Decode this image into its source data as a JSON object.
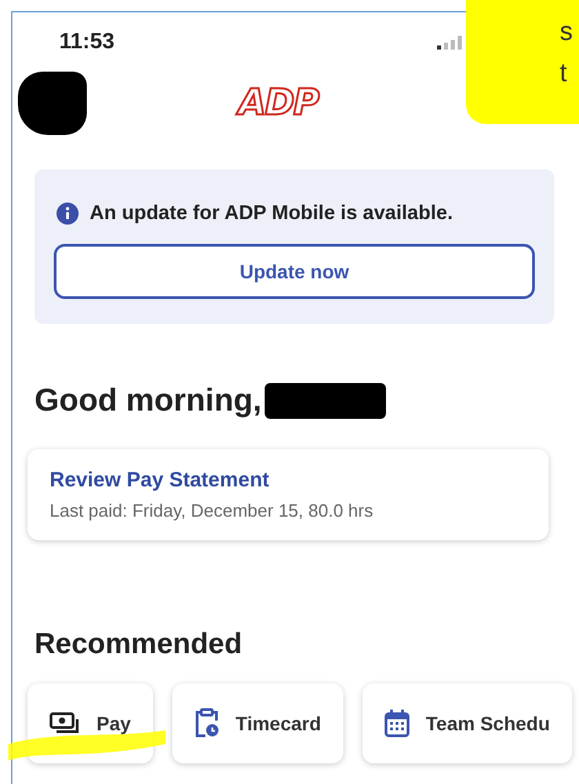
{
  "status_bar": {
    "time": "11:53"
  },
  "header": {
    "logo": "ADP"
  },
  "update_banner": {
    "message": "An update for ADP Mobile is available.",
    "button": "Update now"
  },
  "greeting": "Good morning,",
  "pay_card": {
    "title": "Review Pay Statement",
    "subtitle": "Last paid: Friday, December 15, 80.0 hrs"
  },
  "recommended": {
    "heading": "Recommended",
    "tiles": [
      {
        "kind": "pay",
        "label": "Pay"
      },
      {
        "kind": "timecard",
        "label": "Timecard"
      },
      {
        "kind": "schedule",
        "label": "Team Schedu"
      }
    ]
  },
  "sticky_note": {
    "lines": [
      "s",
      "t"
    ]
  }
}
